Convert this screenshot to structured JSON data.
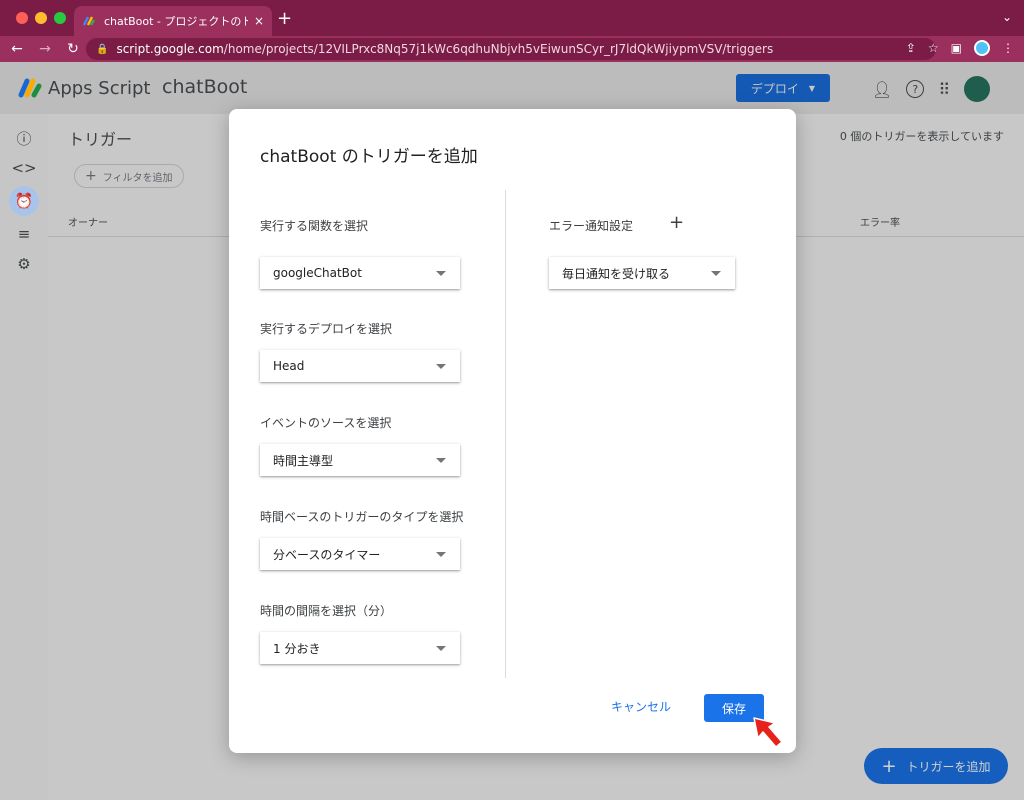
{
  "browser": {
    "tab_title": "chatBoot - プロジェクトのトリガ",
    "tab_close": "×",
    "new_tab": "+",
    "url_host": "script.google.com",
    "url_path": "/home/projects/12VILPrxc8Nq57j1kWc6qdhuNbjvh5vEiwunSCyr_rJ7ldQkWjiypmVSV/triggers"
  },
  "app": {
    "brand": "Apps Script",
    "project_name": "chatBoot",
    "deploy_label": "デプロイ"
  },
  "page": {
    "title": "トリガー",
    "trigger_count": "0 個のトリガーを表示しています",
    "filter_label": "フィルタを追加",
    "columns": {
      "owner": "オーナー",
      "error_rate": "エラー率"
    },
    "fab_label": "トリガーを追加"
  },
  "dialog": {
    "title": "chatBoot のトリガーを追加",
    "fields": [
      {
        "label": "実行する関数を選択",
        "value": "googleChatBot"
      },
      {
        "label": "実行するデプロイを選択",
        "value": "Head"
      },
      {
        "label": "イベントのソースを選択",
        "value": "時間主導型"
      },
      {
        "label": "時間ベースのトリガーのタイプを選択",
        "value": "分ベースのタイマー"
      },
      {
        "label": "時間の間隔を選択（分）",
        "value": "1 分おき"
      }
    ],
    "error_notify": {
      "label": "エラー通知設定",
      "value": "毎日通知を受け取る"
    },
    "cancel_label": "キャンセル",
    "save_label": "保存"
  },
  "colors": {
    "accent": "#1a73e8",
    "tab_bar": "#7a1c45",
    "pointer": "#e8221b"
  }
}
